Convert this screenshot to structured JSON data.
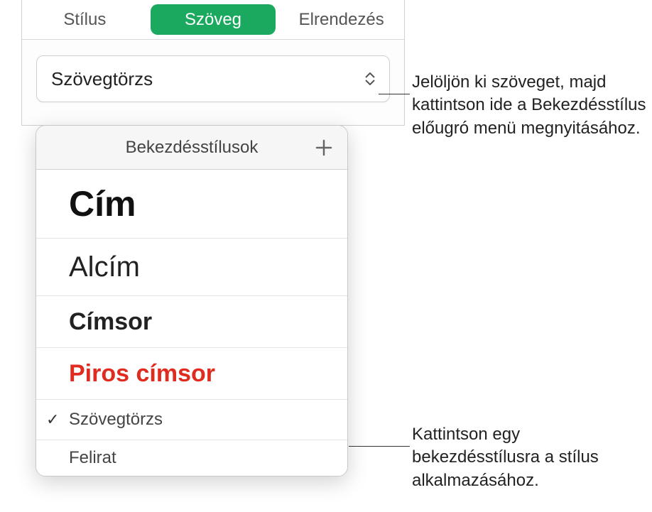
{
  "tabs": {
    "style": "Stílus",
    "text": "Szöveg",
    "layout": "Elrendezés"
  },
  "selector": {
    "current": "Szövegtörzs"
  },
  "popover": {
    "title": "Bekezdésstílusok",
    "items": [
      {
        "label": "Cím",
        "variant": "cim",
        "selected": false
      },
      {
        "label": "Alcím",
        "variant": "alcim",
        "selected": false
      },
      {
        "label": "Címsor",
        "variant": "cimsor",
        "selected": false
      },
      {
        "label": "Piros címsor",
        "variant": "piros",
        "selected": false
      },
      {
        "label": "Szövegtörzs",
        "variant": "torzs",
        "selected": true
      },
      {
        "label": "Felirat",
        "variant": "felirat",
        "selected": false
      }
    ]
  },
  "callouts": {
    "c1": "Jelöljön ki szöveget, majd kattintson ide a Bekezdésstílus előugró menü megnyitásához.",
    "c2": "Kattintson egy bekezdésstílusra a stílus alkalmazásához."
  },
  "colors": {
    "accent": "#1ba85f",
    "danger": "#e02b20"
  }
}
